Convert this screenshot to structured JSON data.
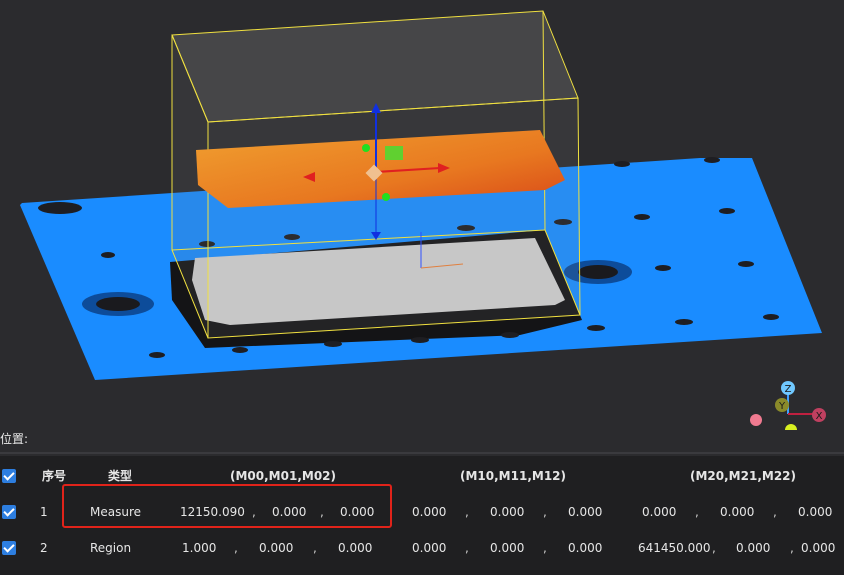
{
  "panel": {
    "label": "位置:"
  },
  "table": {
    "headers": {
      "index": "序号",
      "type": "类型",
      "group0": "(M00,M01,M02)",
      "group1": "(M10,M11,M12)",
      "group2": "(M20,M21,M22)"
    },
    "separator": ",",
    "rows": [
      {
        "index": "1",
        "type": "Measure",
        "checked": true,
        "m00": "12150.090",
        "m01": "0.000",
        "m02": "0.000",
        "m10": "0.000",
        "m11": "0.000",
        "m12": "0.000",
        "m20": "0.000",
        "m21": "0.000",
        "m22": "0.000"
      },
      {
        "index": "2",
        "type": "Region",
        "checked": true,
        "m00": "1.000",
        "m01": "0.000",
        "m02": "0.000",
        "m10": "0.000",
        "m11": "0.000",
        "m12": "0.000",
        "m20": "641450.000",
        "m21": "0.000",
        "m22": "0.000"
      }
    ]
  },
  "gizmo": {
    "z_label": "Z",
    "y_label": "Y",
    "x_label": "X"
  },
  "colors": {
    "background": "#2b2b2e",
    "point_cloud_base": "#1a8cff",
    "bounding_box": "#f0e040",
    "measure_surface": "#e8842a",
    "checkbox": "#2d7ee0",
    "highlight": "#e0231a"
  }
}
